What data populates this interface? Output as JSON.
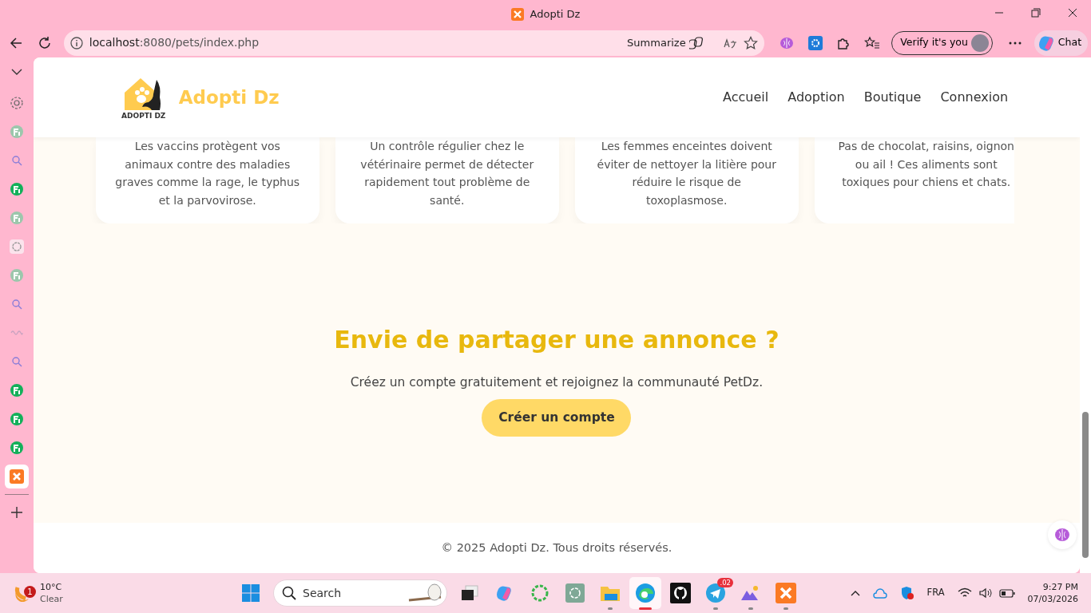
{
  "browser": {
    "tab_title": "Adopti Dz",
    "url_host": "localhost",
    "url_rest": ":8080/pets/index.php",
    "summarize": "Summarize",
    "profile_button": "Verify it's you",
    "chat": "Chat"
  },
  "sidebar": [
    {
      "kind": "settings",
      "selected": false
    },
    {
      "kind": "fi-dim",
      "selected": false
    },
    {
      "kind": "search",
      "selected": false
    },
    {
      "kind": "fi",
      "selected": false
    },
    {
      "kind": "fi-dim",
      "selected": false
    },
    {
      "kind": "spiral",
      "selected": false
    },
    {
      "kind": "fi-dim",
      "selected": false
    },
    {
      "kind": "search",
      "selected": false
    },
    {
      "kind": "wave",
      "selected": false
    },
    {
      "kind": "search",
      "selected": false
    },
    {
      "kind": "fi",
      "selected": false
    },
    {
      "kind": "fi",
      "selected": false
    },
    {
      "kind": "fi",
      "selected": false
    },
    {
      "kind": "xampp",
      "selected": true
    }
  ],
  "site": {
    "brand": "Adopti Dz",
    "logo_text": "ADOPTI DZ",
    "nav": [
      {
        "label": "Accueil"
      },
      {
        "label": "Adoption"
      },
      {
        "label": "Boutique"
      },
      {
        "label": "Connexion"
      }
    ]
  },
  "tips": [
    {
      "text": "Les vaccins protègent vos animaux contre des maladies graves comme la rage, le typhus et la parvovirose."
    },
    {
      "text": "Un contrôle régulier chez le vétérinaire permet de détecter rapidement tout problème de santé."
    },
    {
      "text": "Les femmes enceintes doivent éviter de nettoyer la litière pour réduire le risque de toxoplasmose."
    },
    {
      "text": "Pas de chocolat, raisins, oignon ou ail ! Ces aliments sont toxiques pour chiens et chats."
    }
  ],
  "cta": {
    "title": "Envie de partager une annonce ?",
    "text": "Créez un compte gratuitement et rejoignez la communauté PetDz.",
    "button": "Créer un compte"
  },
  "footer": "© 2025 Adopti Dz. Tous droits réservés.",
  "taskbar": {
    "weather_badge": "1",
    "temperature": "10°C",
    "condition": "Clear",
    "search_placeholder": "Search",
    "language": "FRA",
    "time": "9:27 PM",
    "date": "07/03/2026",
    "apps": [
      {
        "kind": "taskview",
        "open": false,
        "active": false
      },
      {
        "kind": "copilot",
        "open": false,
        "active": false
      },
      {
        "kind": "ring",
        "open": false,
        "active": false
      },
      {
        "kind": "chatgpt",
        "open": false,
        "active": false
      },
      {
        "kind": "files",
        "open": true,
        "active": false
      },
      {
        "kind": "edge",
        "open": true,
        "active": true
      },
      {
        "kind": "github",
        "open": false,
        "active": false
      },
      {
        "kind": "telegram",
        "open": true,
        "active": false,
        "badge": ".02"
      },
      {
        "kind": "mountain",
        "open": true,
        "active": false
      },
      {
        "kind": "xampp",
        "open": true,
        "active": false
      }
    ]
  }
}
